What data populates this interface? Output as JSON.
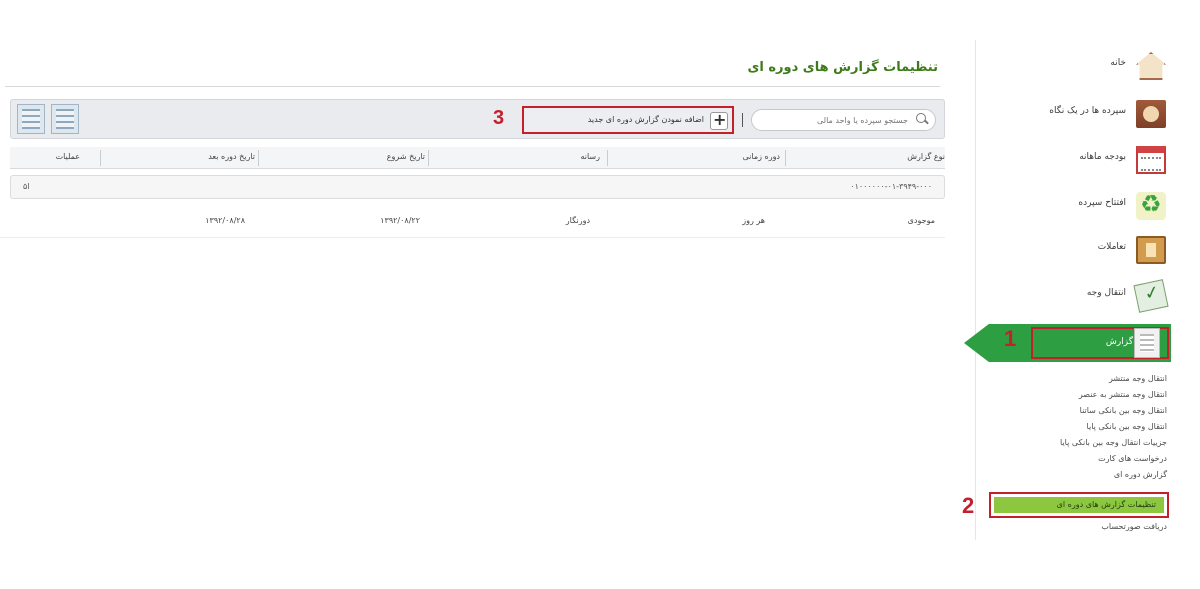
{
  "sidebar": {
    "items": [
      {
        "label": "خانه",
        "icon": "home-icon"
      },
      {
        "label": "سپرده ها در یک نگاه",
        "icon": "book-icon"
      },
      {
        "label": "بودجه ماهانه",
        "icon": "calendar-icon"
      },
      {
        "label": "افتتاح سپرده",
        "icon": "recycle-icon"
      },
      {
        "label": "تعاملات",
        "icon": "booklet-icon"
      },
      {
        "label": "انتقال وجه",
        "icon": "money-transfer-icon"
      }
    ],
    "reports": {
      "label": "گزارش",
      "icon": "report-icon",
      "marker": "1"
    },
    "submenu": [
      "انتقال وجه منتشر",
      "انتقال وجه منتشر به عنصر",
      "انتقال وجه بین بانکی ساتنا",
      "انتقال وجه بین بانکی پایا",
      "جزییات انتقال وجه بین بانکی پایا",
      "درخواست های کارت",
      "گزارش دوره ای"
    ],
    "submenu_selected": {
      "label": "تنظیمات گزارش های دوره ای",
      "marker": "2"
    },
    "submenu_after": "دریافت صورتحساب"
  },
  "main": {
    "title": "تنظیمات گزارش های دوره ای",
    "toolbar": {
      "search_placeholder": "جستجو سپرده یا واحد مالی",
      "add_button_label": "اضافه نمودن گزارش دوره ای جدید",
      "marker": "3"
    },
    "table": {
      "headers": [
        "نوع گزارش",
        "دوره زمانی",
        "رسانه",
        "تاریخ شروع",
        "تاریخ دوره بعد",
        "عملیات"
      ],
      "group_label": "۰۱۰۰۰۰۰۰-۰۱-۳۹۴۹-۰۰۰",
      "group_left": "ا۵",
      "rows": [
        {
          "type": "موجودی",
          "period": "هر روز",
          "media": "دورنگار",
          "start": "۱۳۹۲/۰۸/۲۲",
          "next": "۱۳۹۲/۰۸/۲۸"
        }
      ]
    }
  },
  "colors": {
    "accent_green": "#2e9e43",
    "selected_green": "#8dc63f",
    "highlight_red": "#c41f2b",
    "title_green": "#3d7a1a"
  }
}
